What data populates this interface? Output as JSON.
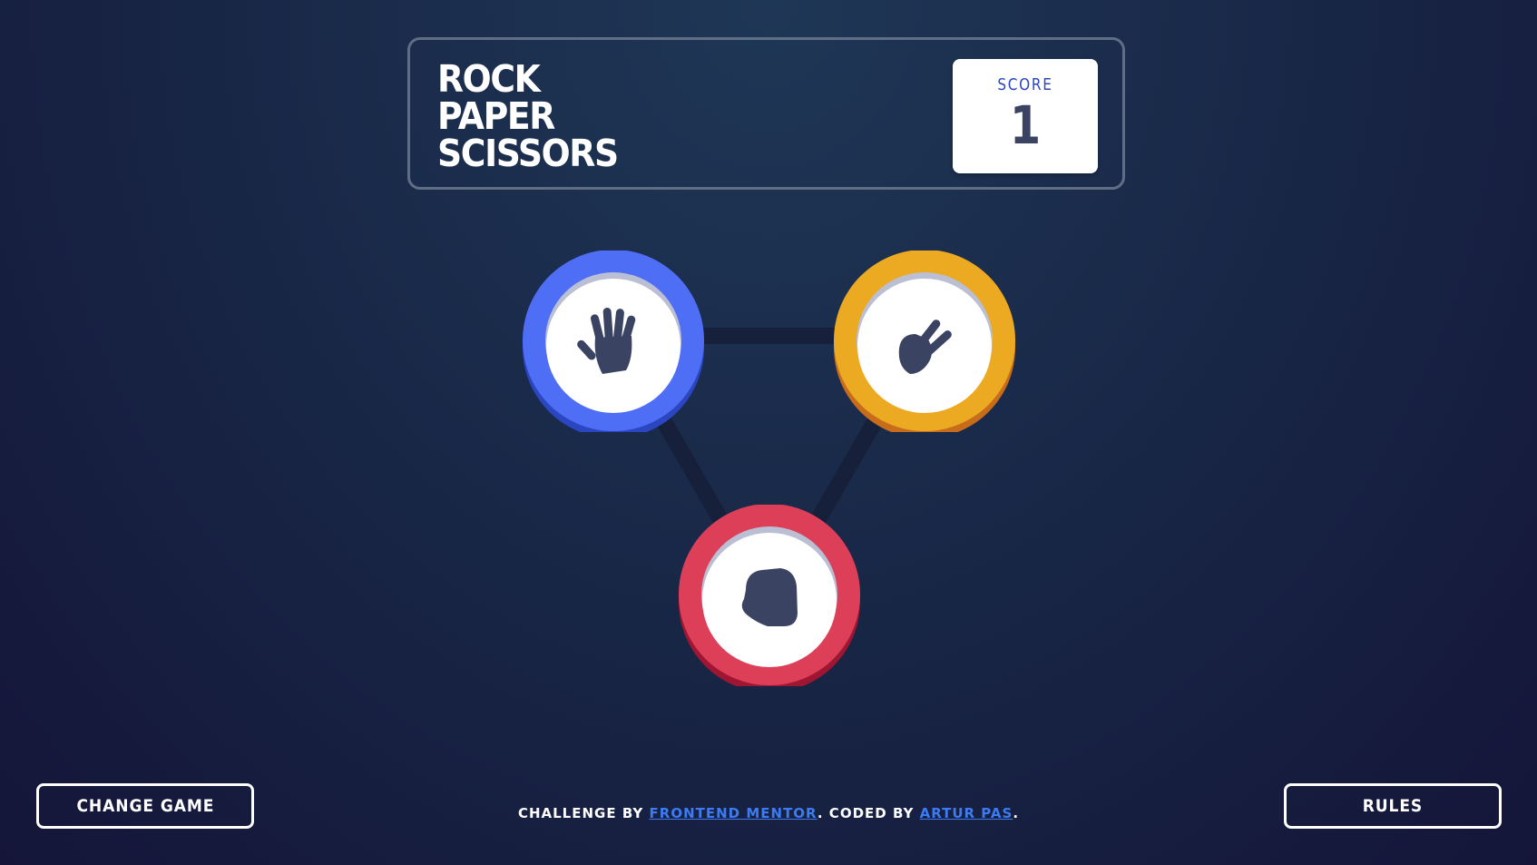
{
  "header": {
    "title_lines": [
      "ROCK",
      "PAPER",
      "SCISSORS"
    ],
    "score_label": "SCORE",
    "score_value": "1"
  },
  "choices": [
    {
      "name": "paper",
      "icon": "paper-hand-icon",
      "color": "#4f6ef6",
      "shadow": "#2a46c0"
    },
    {
      "name": "scissors",
      "icon": "scissors-hand-icon",
      "color": "#eca922",
      "shadow": "#c76c1b"
    },
    {
      "name": "rock",
      "icon": "rock-fist-icon",
      "color": "#dd3f59",
      "shadow": "#9e1632"
    }
  ],
  "footer": {
    "change_game_label": "CHANGE GAME",
    "rules_label": "RULES",
    "attribution": {
      "prefix": "CHALLENGE BY ",
      "link1": "FRONTEND MENTOR",
      "middle": ". CODED BY ",
      "link2": "ARTUR PAS",
      "suffix": "."
    }
  },
  "colors": {
    "background": "#1f3756",
    "link": "#3d7bf2",
    "score_label": "#2a46c0",
    "score_value": "#3b4363",
    "icon": "#3b4363"
  }
}
